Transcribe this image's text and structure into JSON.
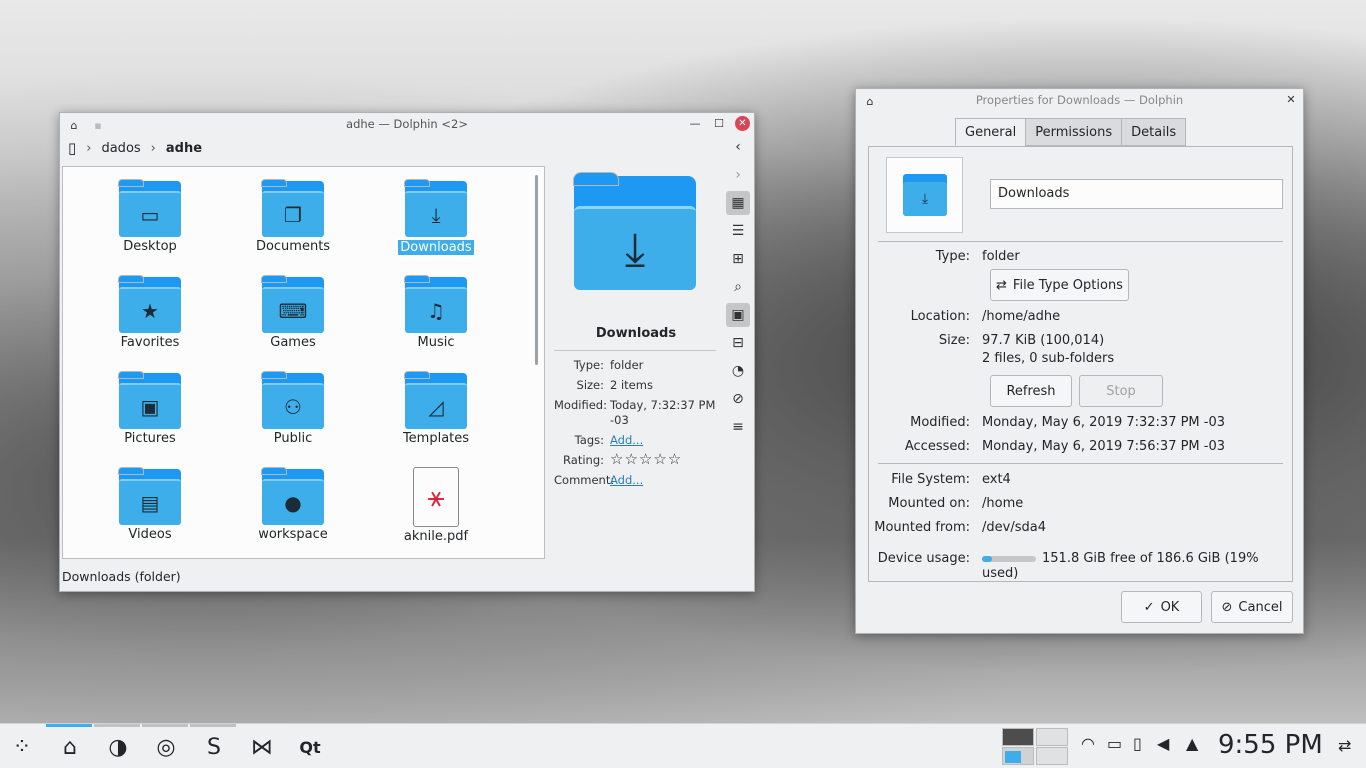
{
  "dolphin": {
    "title": "adhe — Dolphin <2>",
    "breadcrumb": [
      "dados",
      "adhe"
    ],
    "files": [
      {
        "label": "Desktop",
        "icon": "desktop-icon",
        "glyph": "▭"
      },
      {
        "label": "Documents",
        "icon": "documents-icon",
        "glyph": "❐"
      },
      {
        "label": "Downloads",
        "icon": "download-icon",
        "glyph": "⤓",
        "selected": true
      },
      {
        "label": "Favorites",
        "icon": "star-icon",
        "glyph": "★"
      },
      {
        "label": "Games",
        "icon": "gamepad-icon",
        "glyph": "⌨"
      },
      {
        "label": "Music",
        "icon": "music-icon",
        "glyph": "♫"
      },
      {
        "label": "Pictures",
        "icon": "picture-icon",
        "glyph": "▣"
      },
      {
        "label": "Public",
        "icon": "people-icon",
        "glyph": "⚇"
      },
      {
        "label": "Templates",
        "icon": "template-icon",
        "glyph": "◿"
      },
      {
        "label": "Videos",
        "icon": "film-icon",
        "glyph": "▤"
      },
      {
        "label": "workspace",
        "icon": "github-icon",
        "glyph": "●"
      },
      {
        "label": "aknile.pdf",
        "icon": "pdf-icon",
        "glyph": "",
        "pdf": true
      }
    ],
    "info": {
      "name": "Downloads",
      "type_label": "Type:",
      "type": "folder",
      "size_label": "Size:",
      "size": "2 items",
      "modified_label": "Modified:",
      "modified": "Today, 7:32:37 PM -03",
      "tags_label": "Tags:",
      "tags": "Add...",
      "rating_label": "Rating:",
      "rating": 0,
      "comment_label": "Comment:",
      "comment": "Add..."
    },
    "status": "Downloads (folder)"
  },
  "props": {
    "title": "Properties for Downloads — Dolphin",
    "tabs": [
      "General",
      "Permissions",
      "Details"
    ],
    "name_value": "Downloads",
    "type_label": "Type:",
    "type": "folder",
    "file_type_options": "File Type Options",
    "location_label": "Location:",
    "location": "/home/adhe",
    "size_label": "Size:",
    "size": "97.7 KiB (100,014)",
    "size_detail": "2 files, 0 sub-folders",
    "refresh": "Refresh",
    "stop": "Stop",
    "modified_label": "Modified:",
    "modified": "Monday, May 6, 2019 7:32:37 PM -03",
    "accessed_label": "Accessed:",
    "accessed": "Monday, May 6, 2019 7:56:37 PM -03",
    "fs_label": "File System:",
    "fs": "ext4",
    "mounted_on_label": "Mounted on:",
    "mounted_on": "/home",
    "mounted_from_label": "Mounted from:",
    "mounted_from": "/dev/sda4",
    "usage_label": "Device usage:",
    "usage": "151.8 GiB free of 186.6 GiB (19% used)",
    "usage_fraction": 0.19,
    "ok": "OK",
    "cancel": "Cancel"
  },
  "taskbar": {
    "clock": "9:55 PM",
    "qt_label": "Qt"
  }
}
